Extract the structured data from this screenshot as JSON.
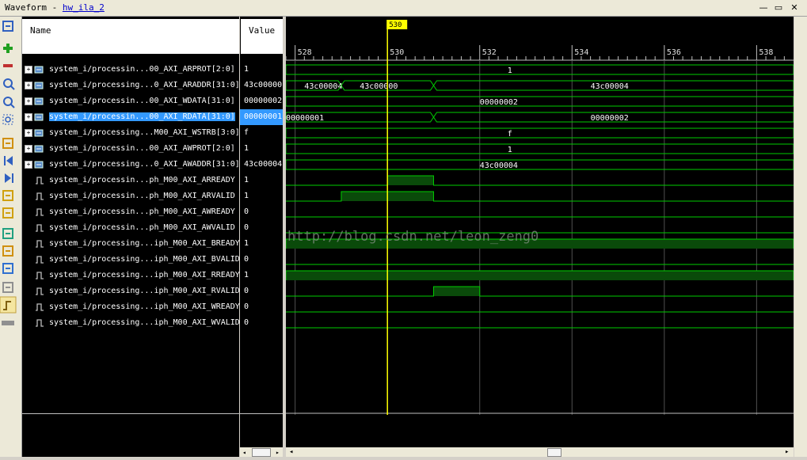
{
  "window": {
    "title": "Waveform",
    "separator": " - ",
    "subtitle_link": "hw_ila_2",
    "controls": [
      "—",
      "▭",
      "✕"
    ]
  },
  "columns": {
    "name": "Name",
    "value": "Value"
  },
  "toolbar_icons": [
    "fit-icon",
    "zoom-add-icon",
    "remove-icon",
    "zoom-in-icon",
    "zoom-out-icon",
    "zoom-fit-icon",
    "goto-cursor-icon",
    "go-start-icon",
    "go-end-icon",
    "prev-transition-icon",
    "next-transition-icon",
    "add-marker-icon",
    "prev-marker-icon",
    "next-marker-icon",
    "swap-cursor-icon",
    "snap-transition-icon",
    "float-ruler-icon"
  ],
  "cursor": {
    "label": "530",
    "time": 530
  },
  "timeline": {
    "start": 527.8,
    "end": 538.8,
    "ticks": [
      "528",
      "530",
      "532",
      "534",
      "536",
      "538"
    ]
  },
  "signals": [
    {
      "name": "system_i/processin...00_AXI_ARPROT[2:0]",
      "value": "1",
      "bus": true,
      "wave": {
        "type": "bus",
        "segments": [
          {
            "from": 527.8,
            "to": 538.8,
            "label": "1",
            "labelAt": 532.6
          }
        ]
      }
    },
    {
      "name": "system_i/processing...0_AXI_ARADDR[31:0]",
      "value": "43c00000",
      "bus": true,
      "wave": {
        "type": "bus",
        "segments": [
          {
            "from": 527.8,
            "to": 529,
            "label": "43c00004",
            "labelAt": 528.2
          },
          {
            "from": 529,
            "to": 531,
            "label": "43c00000",
            "labelAt": 529.4
          },
          {
            "from": 531,
            "to": 538.8,
            "label": "43c00004",
            "labelAt": 534.4
          }
        ]
      }
    },
    {
      "name": "system_i/processin...00_AXI_WDATA[31:0]",
      "value": "00000002",
      "bus": true,
      "wave": {
        "type": "bus",
        "segments": [
          {
            "from": 527.8,
            "to": 538.8,
            "label": "00000002",
            "labelAt": 532
          }
        ]
      }
    },
    {
      "name": "system_i/processin...00_AXI_RDATA[31:0]",
      "value": "00000001",
      "bus": true,
      "selected": true,
      "wave": {
        "type": "bus",
        "segments": [
          {
            "from": 527.8,
            "to": 531,
            "label": "00000001",
            "labelAt": 527.8
          },
          {
            "from": 531,
            "to": 538.8,
            "label": "00000002",
            "labelAt": 534.4
          }
        ]
      }
    },
    {
      "name": "system_i/processing...M00_AXI_WSTRB[3:0]",
      "value": "f",
      "bus": true,
      "wave": {
        "type": "bus",
        "segments": [
          {
            "from": 527.8,
            "to": 538.8,
            "label": "f",
            "labelAt": 532.6
          }
        ]
      }
    },
    {
      "name": "system_i/processin...00_AXI_AWPROT[2:0]",
      "value": "1",
      "bus": true,
      "wave": {
        "type": "bus",
        "segments": [
          {
            "from": 527.8,
            "to": 538.8,
            "label": "1",
            "labelAt": 532.6
          }
        ]
      }
    },
    {
      "name": "system_i/processing...0_AXI_AWADDR[31:0]",
      "value": "43c00004",
      "bus": true,
      "wave": {
        "type": "bus",
        "segments": [
          {
            "from": 527.8,
            "to": 538.8,
            "label": "43c00004",
            "labelAt": 532
          }
        ]
      }
    },
    {
      "name": "system_i/processin...ph_M00_AXI_ARREADY",
      "value": "1",
      "bus": false,
      "wave": {
        "type": "bit",
        "high": [
          [
            530,
            531
          ]
        ]
      }
    },
    {
      "name": "system_i/processin...ph_M00_AXI_ARVALID",
      "value": "1",
      "bus": false,
      "wave": {
        "type": "bit",
        "high": [
          [
            529,
            531
          ]
        ]
      }
    },
    {
      "name": "system_i/processin...ph_M00_AXI_AWREADY",
      "value": "0",
      "bus": false,
      "wave": {
        "type": "bit",
        "high": []
      }
    },
    {
      "name": "system_i/processin...ph_M00_AXI_AWVALID",
      "value": "0",
      "bus": false,
      "wave": {
        "type": "bit",
        "high": []
      }
    },
    {
      "name": "system_i/processing...iph_M00_AXI_BREADY",
      "value": "1",
      "bus": false,
      "wave": {
        "type": "bit",
        "high": [
          [
            527.8,
            538.8
          ]
        ]
      }
    },
    {
      "name": "system_i/processing...iph_M00_AXI_BVALID",
      "value": "0",
      "bus": false,
      "wave": {
        "type": "bit",
        "high": []
      }
    },
    {
      "name": "system_i/processing...iph_M00_AXI_RREADY",
      "value": "1",
      "bus": false,
      "wave": {
        "type": "bit",
        "high": [
          [
            527.8,
            538.8
          ]
        ]
      }
    },
    {
      "name": "system_i/processing...iph_M00_AXI_RVALID",
      "value": "0",
      "bus": false,
      "wave": {
        "type": "bit",
        "high": [
          [
            531,
            532
          ]
        ]
      }
    },
    {
      "name": "system_i/processing...iph_M00_AXI_WREADY",
      "value": "0",
      "bus": false,
      "wave": {
        "type": "bit",
        "high": []
      }
    },
    {
      "name": "system_i/processing...iph_M00_AXI_WVALID",
      "value": "0",
      "bus": false,
      "wave": {
        "type": "bit",
        "high": []
      }
    }
  ],
  "watermark": "http://blog.csdn.net/leon_zeng0",
  "colors": {
    "wave": "#00cc00",
    "waveFill": "#0a4a0a",
    "cursor": "#ffff00",
    "selected": "#3399ff",
    "grid": "#505050"
  }
}
